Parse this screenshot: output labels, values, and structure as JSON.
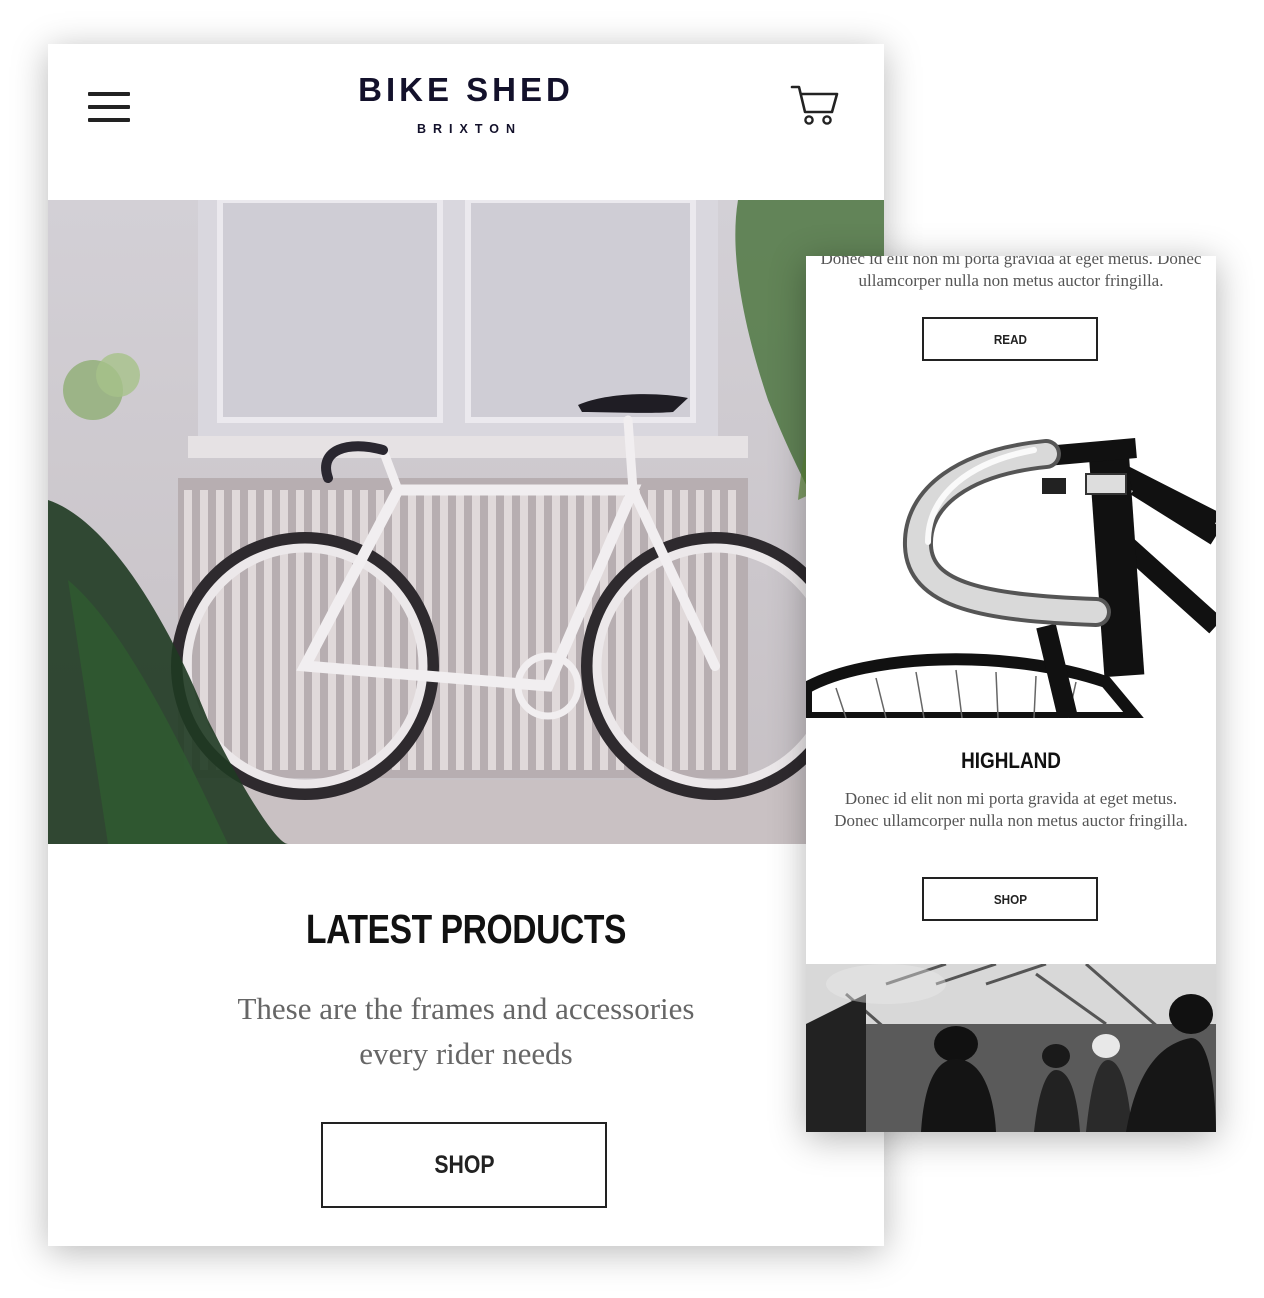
{
  "brand": {
    "name": "BIKE SHED",
    "location": "BRIXTON",
    "color": "#13112b"
  },
  "header": {
    "menu_icon": "hamburger-icon",
    "cart_icon": "shopping-cart-icon"
  },
  "main": {
    "section_title": "LATEST PRODUCTS",
    "section_desc_line1": "These are the frames and accessories",
    "section_desc_line2": "every rider needs",
    "shop_label": "SHOP"
  },
  "secondary": {
    "cut_text_line1": "Donec id elit non mi porta gravida at eget metus. Donec",
    "cut_text_line2": "ullamcorper nulla non metus auctor fringilla.",
    "read_label": "READ",
    "product_title": "HIGHLAND",
    "product_desc_line1": "Donec id elit non mi porta gravida at eget metus.",
    "product_desc_line2": "Donec ullamcorper nulla non metus auctor fringilla.",
    "shop_label": "SHOP"
  }
}
